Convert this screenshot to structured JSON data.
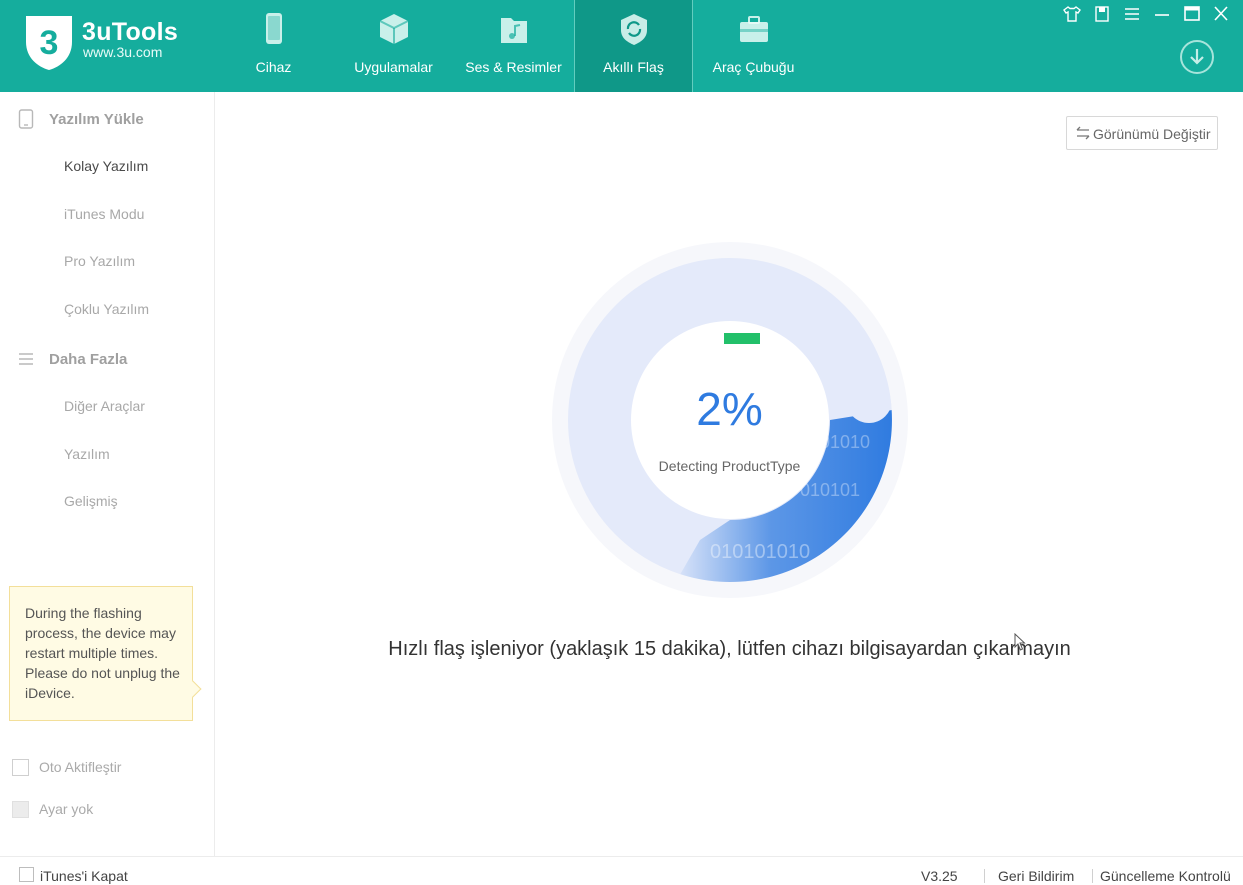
{
  "app": {
    "name": "3uTools",
    "url": "www.3u.com",
    "logo_digit": "3"
  },
  "nav": {
    "items": [
      {
        "label": "Cihaz",
        "icon": "phone-icon"
      },
      {
        "label": "Uygulamalar",
        "icon": "cube-icon"
      },
      {
        "label": "Ses & Resimler",
        "icon": "music-folder-icon"
      },
      {
        "label": "Akıllı Flaş",
        "icon": "shield-refresh-icon"
      },
      {
        "label": "Araç Çubuğu",
        "icon": "toolbox-icon"
      }
    ],
    "active_index": 3
  },
  "window_controls": [
    "shirt-icon",
    "bookmark-icon",
    "menu-icon",
    "minimize-icon",
    "maximize-icon",
    "close-icon"
  ],
  "sidebar": {
    "group1": {
      "label": "Yazılım Yükle",
      "icon": "tablet-icon"
    },
    "group1_items": [
      "Kolay Yazılım",
      "iTunes Modu",
      "Pro Yazılım",
      "Çoklu Yazılım"
    ],
    "group2": {
      "label": "Daha Fazla",
      "icon": "list-icon"
    },
    "group2_items": [
      "Diğer Araçlar",
      "Yazılım",
      "Gelişmiş"
    ],
    "active_item": "Kolay Yazılım",
    "tip": "During the flashing process, the device may restart multiple times. Please do not unplug the iDevice.",
    "checkboxes": [
      {
        "label": "Oto Aktifleştir",
        "checked": false,
        "disabled": false
      },
      {
        "label": "Ayar yok",
        "checked": false,
        "disabled": true
      }
    ]
  },
  "main": {
    "view_button": "Görünümü Değiştir",
    "progress": {
      "percent_text": "2%",
      "value": 0.02,
      "status": "Detecting ProductType",
      "binary_text": [
        "01010",
        "010101",
        "010101010"
      ]
    },
    "message": "Hızlı flaş işleniyor (yaklaşık 15 dakika), lütfen cihazı bilgisayardan çıkarmayın"
  },
  "statusbar": {
    "itunes_close": "iTunes'i Kapat",
    "version": "V3.25",
    "feedback": "Geri Bildirim",
    "update": "Güncelleme Kontrolü"
  },
  "colors": {
    "header": "#15ad9d",
    "accent_blue": "#2f7be0",
    "ring_bg": "#e4eafa",
    "progress_green": "#22c06a"
  }
}
